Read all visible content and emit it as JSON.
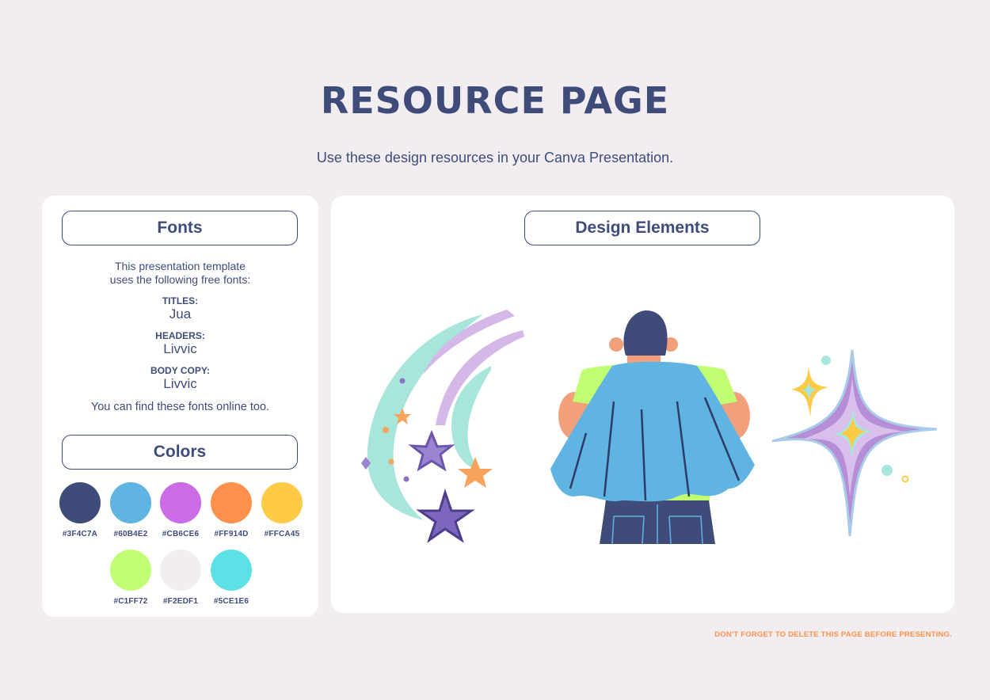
{
  "page": {
    "title": "RESOURCE PAGE",
    "subtitle": "Use these design resources in your Canva Presentation.",
    "footer_note": "DON'T FORGET TO DELETE THIS PAGE BEFORE PRESENTING."
  },
  "fonts_card": {
    "header": "Fonts",
    "intro_line1": "This presentation template",
    "intro_line2": "uses the following free fonts:",
    "entries": [
      {
        "label": "TITLES:",
        "font": "Jua"
      },
      {
        "label": "HEADERS:",
        "font": "Livvic"
      },
      {
        "label": "BODY COPY:",
        "font": "Livvic"
      }
    ],
    "outro": "You can find these fonts online too."
  },
  "colors_card": {
    "header": "Colors",
    "swatches": [
      {
        "hex": "#3F4C7A",
        "color": "#3F4C7A"
      },
      {
        "hex": "#60B4E2",
        "color": "#60B4E2"
      },
      {
        "hex": "#CB6CE6",
        "color": "#CB6CE6"
      },
      {
        "hex": "#FF914D",
        "color": "#FF914D"
      },
      {
        "hex": "#FFCA45",
        "color": "#FFCA45"
      },
      {
        "hex": "#C1FF72",
        "color": "#C1FF72"
      },
      {
        "hex": "#F2EDF1",
        "color": "#F2EDF1"
      },
      {
        "hex": "#5CE1E6",
        "color": "#5CE1E6"
      }
    ]
  },
  "design_card": {
    "header": "Design Elements",
    "elements": [
      "shooting-stars-illustration",
      "caped-hero-illustration",
      "sparkle-stars-illustration"
    ]
  }
}
